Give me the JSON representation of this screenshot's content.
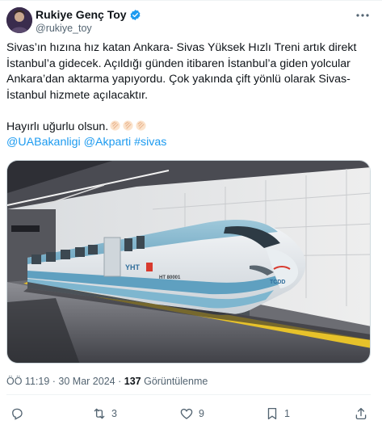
{
  "author": {
    "name": "Rukiye Genç Toy",
    "handle": "@rukiye_toy"
  },
  "tweet": {
    "line1": "Sivas’ın hızına hız katan Ankara- Sivas Yüksek Hızlı Treni artık direkt",
    "line2": "İstanbul’a gidecek. Açıldığı günden itibaren İstanbul’a giden yolcular",
    "line3": "Ankara’dan aktarma yapıyordu. Çok yakında çift yönlü olarak Sivas-",
    "line4": "İstanbul hizmete açılacaktır.",
    "line5": "Hayırlı uğurlu olsun.",
    "mention1": "@UABakanligi",
    "mention2": "@Akparti",
    "hashtag": "#sivas"
  },
  "media": {
    "train_label": "YHT",
    "train_number": "HT 80001",
    "brand": "TCDD"
  },
  "meta": {
    "time": "ÖÖ 11:19",
    "separator": "·",
    "date": "30 Mar 2024",
    "views": "137",
    "views_label": "Görüntülenme"
  },
  "actions": {
    "retweets": "3",
    "likes": "9",
    "bookmarks": "1"
  },
  "colors": {
    "accent": "#1d9bf0",
    "secondary_text": "#536471",
    "text": "#0f1419"
  }
}
